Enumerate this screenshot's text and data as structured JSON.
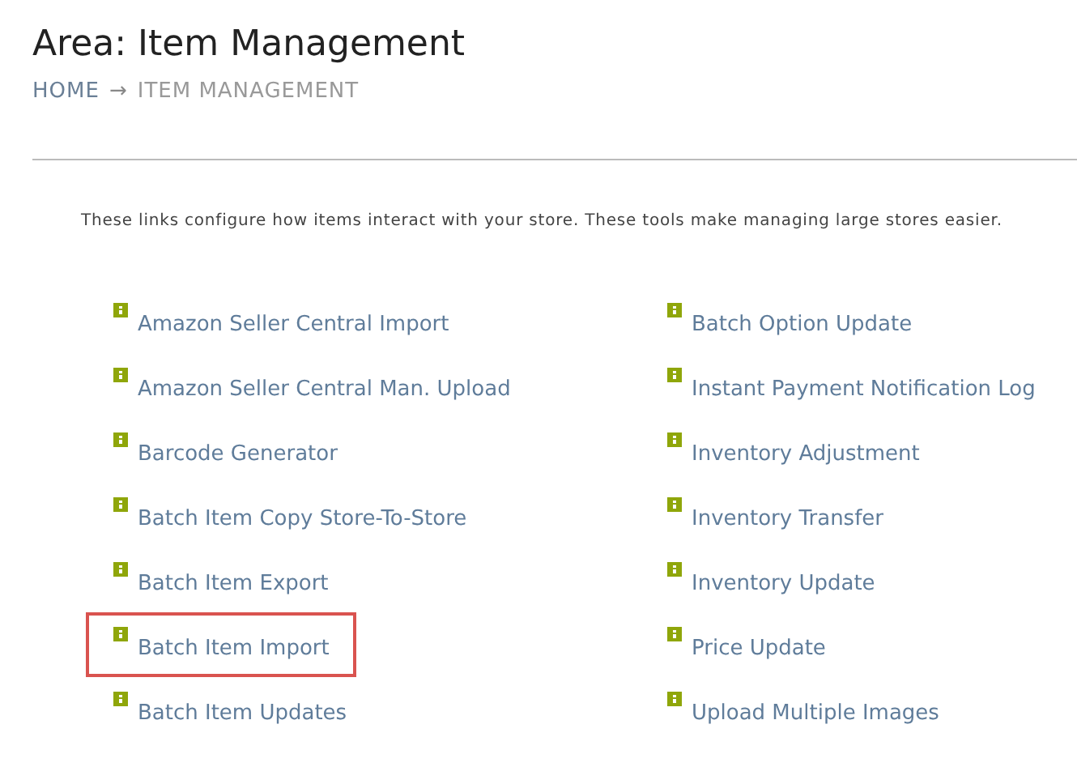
{
  "title": "Area: Item Management",
  "breadcrumb": {
    "home": "HOME",
    "separator": "→",
    "current": "ITEM MANAGEMENT"
  },
  "description": "These links configure how items interact with your store. These tools make managing large stores easier.",
  "columns": [
    [
      {
        "label": "Amazon Seller Central Import",
        "highlighted": false
      },
      {
        "label": "Amazon Seller Central Man. Upload",
        "highlighted": false
      },
      {
        "label": "Barcode Generator",
        "highlighted": false
      },
      {
        "label": "Batch Item Copy Store-To-Store",
        "highlighted": false
      },
      {
        "label": "Batch Item Export",
        "highlighted": false
      },
      {
        "label": "Batch Item Import",
        "highlighted": true
      },
      {
        "label": "Batch Item Updates",
        "highlighted": false
      }
    ],
    [
      {
        "label": "Batch Option Update",
        "highlighted": false
      },
      {
        "label": "Instant Payment Notification Log",
        "highlighted": false
      },
      {
        "label": "Inventory Adjustment",
        "highlighted": false
      },
      {
        "label": "Inventory Transfer",
        "highlighted": false
      },
      {
        "label": "Inventory Update",
        "highlighted": false
      },
      {
        "label": "Price Update",
        "highlighted": false
      },
      {
        "label": "Upload Multiple Images",
        "highlighted": false
      }
    ]
  ]
}
